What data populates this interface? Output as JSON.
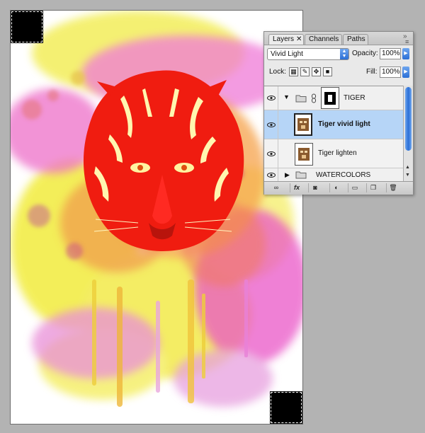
{
  "panel": {
    "tabs": [
      {
        "label": "Layers",
        "close": "✕",
        "active": true
      },
      {
        "label": "Channels",
        "active": false
      },
      {
        "label": "Paths",
        "active": false
      }
    ],
    "menu_icon": "panel-menu-icon",
    "blend_mode": "Vivid Light",
    "opacity_label": "Opacity:",
    "opacity_value": "100%",
    "lock_label": "Lock:",
    "fill_label": "Fill:",
    "fill_value": "100%",
    "layers": [
      {
        "name": "TIGER",
        "type": "group",
        "expanded": true,
        "visible": true
      },
      {
        "name": "Tiger vivid light",
        "type": "layer",
        "selected": true,
        "visible": true
      },
      {
        "name": "Tiger lighten",
        "type": "layer",
        "selected": false,
        "visible": true
      },
      {
        "name": "WATERCOLORS",
        "type": "group",
        "expanded": false,
        "visible": true
      }
    ],
    "footer_buttons": [
      "link-icon",
      "fx-icon",
      "mask-icon",
      "adjustment-icon",
      "new-group-icon",
      "new-layer-icon",
      "trash-icon"
    ],
    "fx_label": "fx"
  },
  "colors": {
    "selection": "#b6d5f7",
    "accent": "#2b6fd6",
    "tiger_red": "#f01c10",
    "magenta": "#ec5bd0",
    "yellow": "#f4ee45"
  }
}
